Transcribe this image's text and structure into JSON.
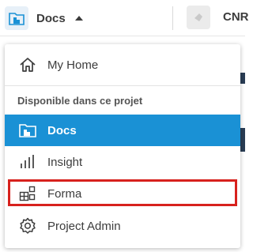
{
  "topbar": {
    "app_name": "Docs",
    "project_name": "CNR"
  },
  "menu": {
    "home_label": "My Home",
    "section_label": "Disponible dans ce projet",
    "items": [
      {
        "label": "Docs",
        "icon": "docs-folder-icon",
        "active": true
      },
      {
        "label": "Insight",
        "icon": "insight-chart-icon",
        "active": false
      },
      {
        "label": "Forma",
        "icon": "forma-blocks-icon",
        "active": false,
        "highlighted": true
      },
      {
        "label": "Project Admin",
        "icon": "gear-icon",
        "active": false
      }
    ]
  },
  "colors": {
    "active": "#1a91d5",
    "highlight": "#d7211d",
    "icon_bg": "#e7f0f8"
  }
}
